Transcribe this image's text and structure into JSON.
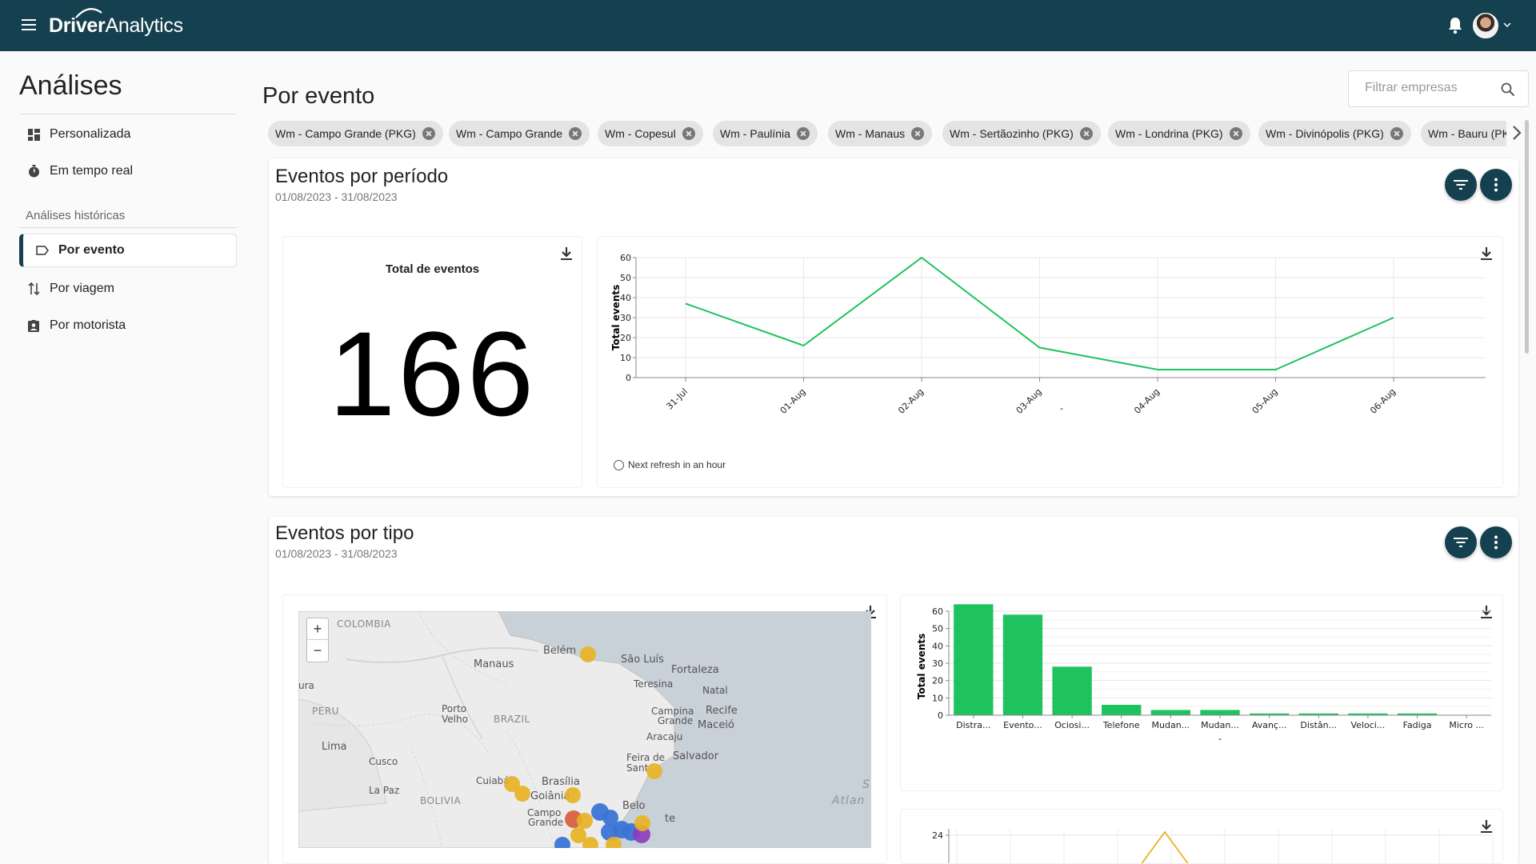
{
  "app": {
    "logo_bold": "Driver",
    "logo_light": "Analytics"
  },
  "sidebar": {
    "title": "Análises",
    "items": [
      {
        "label": "Personalizada",
        "icon": "dashboard-icon"
      },
      {
        "label": "Em tempo real",
        "icon": "timer-icon"
      }
    ],
    "section_label": "Análises históricas",
    "history_items": [
      {
        "label": "Por evento",
        "icon": "label-icon",
        "active": true
      },
      {
        "label": "Por viagem",
        "icon": "route-icon"
      },
      {
        "label": "Por motorista",
        "icon": "badge-icon"
      }
    ]
  },
  "page": {
    "title": "Por evento",
    "search_placeholder": "Filtrar empresas",
    "chips": [
      "Wm - Campo Grande (PKG)",
      "Wm - Campo Grande",
      "Wm - Copesul",
      "Wm - Paulínia",
      "Wm - Manaus",
      "Wm - Sertãozinho (PKG)",
      "Wm - Londrina (PKG)",
      "Wm - Divinópolis (PKG)",
      "Wm - Bauru (PKG)"
    ]
  },
  "panel1": {
    "title": "Eventos por período",
    "date_range": "01/08/2023 - 31/08/2023",
    "total_label": "Total de eventos",
    "total_value": "166",
    "refresh_text": "Next refresh in an hour"
  },
  "panel2": {
    "title": "Eventos por tipo",
    "date_range": "01/08/2023 - 31/08/2023",
    "map_labels": {
      "colombia": "COLOMBIA",
      "belem": "Belém",
      "sao_luis": "São Luís",
      "fortaleza": "Fortaleza",
      "manaus": "Manaus",
      "teresina": "Teresina",
      "natal": "Natal",
      "ura": "ura",
      "peru": "PERU",
      "porto_velho_1": "Porto",
      "porto_velho_2": "Velho",
      "brazil": "BRAZIL",
      "campina_1": "Campina",
      "campina_2": "Grande",
      "recife": "Recife",
      "maceio": "Maceió",
      "aracaju": "Aracaju",
      "lima": "Lima",
      "cusco": "Cusco",
      "feira_1": "Feira de",
      "feira_2": "Sant",
      "salvador": "Salvador",
      "cuiaba": "Cuiabá",
      "brasilia": "Brasília",
      "goiania": "Goiânia",
      "la_paz": "La Paz",
      "bolivia": "BOLIVIA",
      "campo_grande_1": "Campo",
      "campo_grande_2": "Grande",
      "belo": "Belo",
      "te": "te",
      "atlan": "Atlan",
      "s": "S"
    },
    "map_zoom_in": "+",
    "map_zoom_out": "−"
  },
  "chart_data": [
    {
      "type": "line",
      "x": [
        "31-Jul",
        "01-Aug",
        "02-Aug",
        "03-Aug",
        "04-Aug",
        "05-Aug",
        "06-Aug"
      ],
      "series": [
        {
          "values": [
            37,
            16,
            60,
            15,
            4,
            4,
            30
          ]
        }
      ],
      "ylabel": "Total events",
      "xlabel": "-",
      "yticks": [
        0,
        10,
        20,
        30,
        40,
        50,
        60
      ],
      "ylim": [
        0,
        60
      ],
      "color": "#1ec35f"
    },
    {
      "type": "bar",
      "categories": [
        "Distra...",
        "Evento...",
        "Ociosi...",
        "Telefone",
        "Mudan...",
        "Mudan...",
        "Avanç...",
        "Distân...",
        "Veloci...",
        "Fadiga",
        "Micro ..."
      ],
      "values": [
        64,
        58,
        28,
        6,
        3,
        3,
        1,
        1,
        1,
        1,
        0
      ],
      "ylabel": "Total events",
      "xlabel": "-",
      "yticks": [
        0,
        10,
        20,
        30,
        40,
        50,
        60
      ],
      "ylim": [
        0,
        60
      ],
      "color": "#1ec35f"
    },
    {
      "type": "line",
      "yticks": [
        24
      ],
      "visible_partial": true,
      "color": "#e8b321"
    }
  ]
}
